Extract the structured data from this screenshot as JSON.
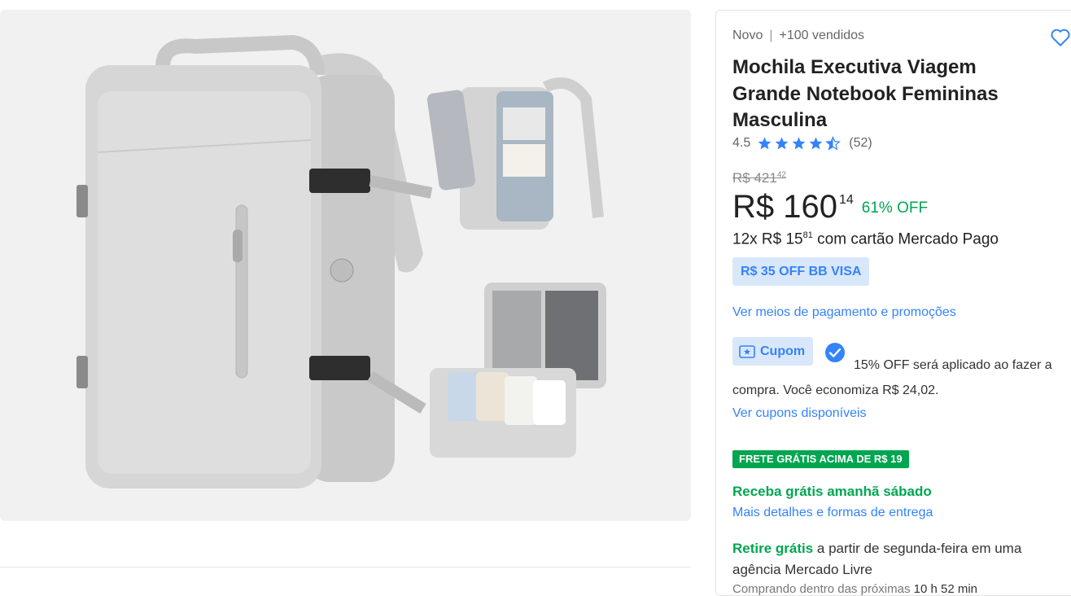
{
  "product": {
    "condition": "Novo",
    "sold": "+100 vendidos",
    "title": "Mochila Executiva Viagem Grande Notebook Femininas Masculina",
    "rating": "4.5",
    "rating_stars": 4.5,
    "reviews": "(52)"
  },
  "price": {
    "old_main": "R$ 421",
    "old_cents": "42",
    "main": "R$ 160",
    "cents": "14",
    "discount": "61% OFF",
    "installments_prefix": "12x R$ 15",
    "installments_cents": "81",
    "installments_suffix": " com cartão Mercado Pago"
  },
  "promo": {
    "chip": "R$ 35 OFF BB VISA",
    "link": "Ver meios de pagamento e promoções"
  },
  "coupon": {
    "chip": "Cupom",
    "text": "15% OFF será aplicado ao fazer a compra. Você economiza R$ 24,02.",
    "link": "Ver cupons disponíveis"
  },
  "shipping": {
    "badge": "FRETE GRÁTIS ACIMA DE R$ 19",
    "delivery": "Receba grátis amanhã sábado",
    "details_link": "Mais detalhes e formas de entrega",
    "pickup_bold": "Retire grátis",
    "pickup_text": " a partir de segunda-feira em uma agência Mercado Livre",
    "countdown_prefix": "Comprando dentro das próximas ",
    "countdown_time": "10 h 52 min"
  },
  "colors": {
    "accent": "#3483fa",
    "green": "#00a650",
    "chip_bg": "#d9e7fa",
    "gallery_bg": "#f1f1f1"
  },
  "icons": [
    "heart-icon",
    "star-icon",
    "half-star-icon",
    "ticket-icon",
    "check-circle-icon"
  ]
}
